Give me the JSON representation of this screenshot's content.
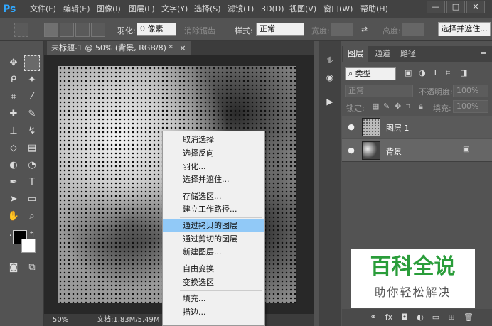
{
  "app": {
    "logo": "Ps"
  },
  "menu": [
    "文件(F)",
    "编辑(E)",
    "图像(I)",
    "图层(L)",
    "文字(Y)",
    "选择(S)",
    "滤镜(T)",
    "3D(D)",
    "视图(V)",
    "窗口(W)",
    "帮助(H)"
  ],
  "window_controls": {
    "minimize": "—",
    "restore": "□",
    "close": "✕"
  },
  "options": {
    "feather_label": "羽化:",
    "feather_value": "0 像素",
    "antialias_label": "消除锯齿",
    "style_label": "样式:",
    "style_value": "正常",
    "width_label": "宽度:",
    "height_label": "高度:",
    "select_mask_button": "选择并遮住..."
  },
  "document": {
    "tab_title": "未标题-1 @ 50% (背景, RGB/8) *",
    "tab_close": "×",
    "zoom": "50%",
    "doc_info": "文档:1.83M/5.49M"
  },
  "context_menu": {
    "items": [
      {
        "label": "取消选择"
      },
      {
        "label": "选择反向"
      },
      {
        "label": "羽化..."
      },
      {
        "label": "选择并遮住..."
      },
      {
        "label": "存储选区..."
      },
      {
        "label": "建立工作路径..."
      },
      {
        "label": "通过拷贝的图层",
        "highlighted": true
      },
      {
        "label": "通过剪切的图层"
      },
      {
        "label": "新建图层..."
      },
      {
        "label": "自由变换"
      },
      {
        "label": "变换选区"
      },
      {
        "label": "填充..."
      },
      {
        "label": "描边..."
      }
    ]
  },
  "layers_panel": {
    "tabs": [
      "图层",
      "通道",
      "路径"
    ],
    "filter_kind": "类型",
    "blend_mode": "正常",
    "opacity_label": "不透明度:",
    "opacity_value": "100%",
    "lock_label": "锁定:",
    "fill_label": "填充:",
    "fill_value": "100%",
    "layers": [
      {
        "name": "图层 1",
        "visible": true
      },
      {
        "name": "背景",
        "visible": true,
        "locked": true
      }
    ]
  },
  "watermark": {
    "title": "百科全说",
    "subtitle": "助你轻松解决"
  },
  "colors": {
    "accent": "#31a8ff",
    "menu_highlight": "#91c9f7",
    "watermark_green": "#2a9d3a"
  }
}
